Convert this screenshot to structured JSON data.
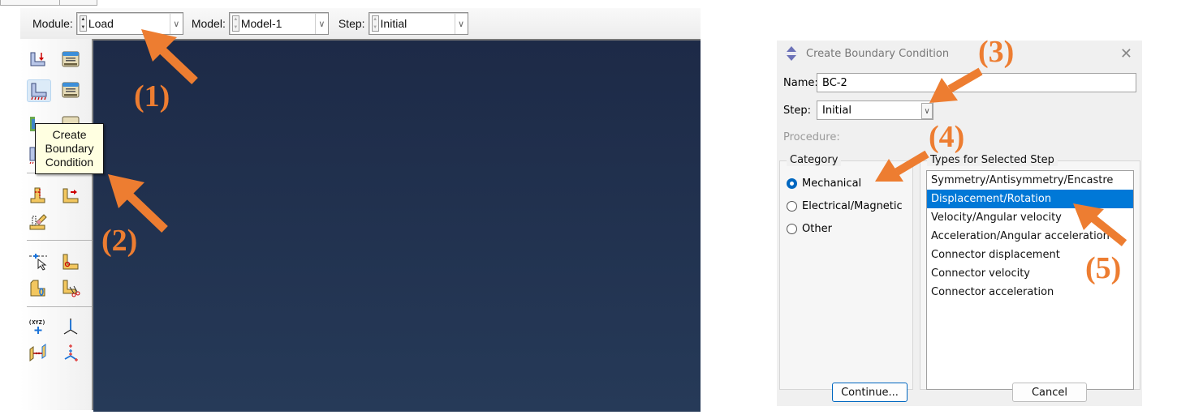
{
  "context_bar": {
    "module_label": "Module:",
    "module_value": "Load",
    "model_label": "Model:",
    "model_value": "Model-1",
    "step_label": "Step:",
    "step_value": "Initial"
  },
  "toolbox": {
    "tools": [
      {
        "name": "create-load",
        "icon": "load-icon"
      },
      {
        "name": "load-manager",
        "icon": "manager-icon"
      },
      {
        "name": "create-boundary-condition",
        "icon": "boundary-condition-icon",
        "active": true
      },
      {
        "name": "bc-manager",
        "icon": "manager-icon"
      },
      {
        "name": "create-predefined-field",
        "icon": "predefined-field-icon"
      },
      {
        "name": "predefined-field-manager",
        "icon": "manager-icon"
      },
      {
        "name": "create-load-case",
        "icon": "load-case-icon"
      },
      {
        "name": "load-case-manager",
        "icon": "manager-icon"
      },
      {
        "name": "partition-cell",
        "icon": "partition-icon"
      },
      {
        "name": "datum-tools",
        "icon": "datum-icon"
      },
      {
        "name": "erase",
        "icon": "eraser-icon"
      },
      {
        "name": "set-tools",
        "icon": "query-icon"
      },
      {
        "name": "surface-tools",
        "icon": "surface-icon"
      },
      {
        "name": "partition-tools",
        "icon": "partition-icon"
      },
      {
        "name": "cut-tools",
        "icon": "scissors-icon"
      },
      {
        "name": "create-csys",
        "icon": "coordinate-system-icon"
      },
      {
        "name": "datum-csys",
        "icon": "axis-icon"
      },
      {
        "name": "connector",
        "icon": "connector-icon"
      },
      {
        "name": "csys-display",
        "icon": "triad-icon"
      }
    ],
    "tooltip": [
      "Create",
      "Boundary",
      "Condition"
    ]
  },
  "dialog": {
    "title": "Create Boundary Condition",
    "name_label": "Name:",
    "name_value": "BC-2",
    "step_label": "Step:",
    "step_value": "Initial",
    "procedure_label": "Procedure:",
    "category_title": "Category",
    "categories": [
      {
        "label": "Mechanical",
        "checked": true
      },
      {
        "label": "Electrical/Magnetic",
        "checked": false
      },
      {
        "label": "Other",
        "checked": false
      }
    ],
    "types_title": "Types for Selected Step",
    "types": [
      {
        "label": "Symmetry/Antisymmetry/Encastre",
        "selected": false
      },
      {
        "label": "Displacement/Rotation",
        "selected": true
      },
      {
        "label": "Velocity/Angular velocity",
        "selected": false
      },
      {
        "label": "Acceleration/Angular acceleration",
        "selected": false
      },
      {
        "label": "Connector displacement",
        "selected": false
      },
      {
        "label": "Connector velocity",
        "selected": false
      },
      {
        "label": "Connector acceleration",
        "selected": false
      }
    ],
    "continue_label": "Continue...",
    "cancel_label": "Cancel"
  },
  "annotations": {
    "color": "#ed7d31",
    "labels": [
      "(1)",
      "(2)",
      "(3)",
      "(4)",
      "(5)"
    ]
  },
  "colors": {
    "viewport": "#1d2a47",
    "selection": "#0078d7",
    "tooltip_bg": "#ffffe1"
  }
}
